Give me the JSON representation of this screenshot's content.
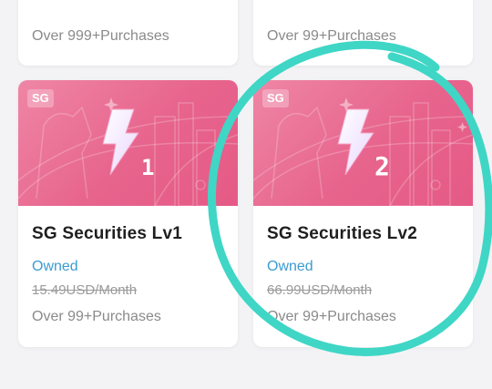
{
  "top_cards": [
    {
      "purchases": "Over 999+Purchases"
    },
    {
      "purchases": "Over 99+Purchases"
    }
  ],
  "products": [
    {
      "badge": "SG",
      "level": "1",
      "title": "SG Securities Lv1",
      "status": "Owned",
      "price": "15.49USD/Month",
      "purchases": "Over 99+Purchases"
    },
    {
      "badge": "SG",
      "level": "2",
      "title": "SG Securities Lv2",
      "status": "Owned",
      "price": "66.99USD/Month",
      "purchases": "Over 99+Purchases"
    }
  ],
  "colors": {
    "banner": "#e7648d",
    "owned": "#3b9bd1",
    "highlight_circle": "#3fd6c6"
  },
  "icons": [
    "lightning-bolt-icon",
    "merlion-icon",
    "sparkle-icon"
  ]
}
